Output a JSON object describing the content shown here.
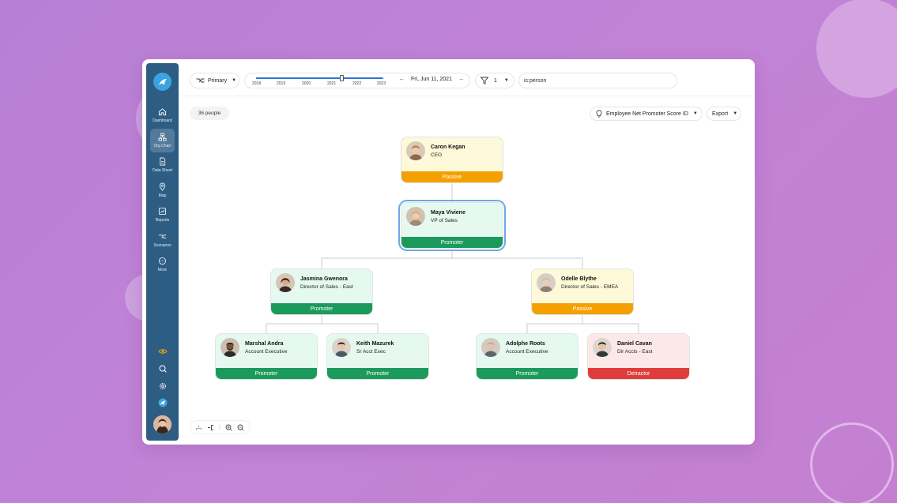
{
  "sidebar": {
    "items": [
      {
        "label": "Dashboard",
        "icon": "home-icon"
      },
      {
        "label": "Org Chart",
        "icon": "org-chart-icon",
        "active": true
      },
      {
        "label": "Data Sheet",
        "icon": "document-icon"
      },
      {
        "label": "Map",
        "icon": "map-pin-icon"
      },
      {
        "label": "Reports",
        "icon": "chart-icon"
      },
      {
        "label": "Scenarios",
        "icon": "scenarios-icon"
      },
      {
        "label": "More",
        "icon": "more-icon"
      }
    ],
    "bottom_icons": [
      "eye-icon",
      "search-icon",
      "gear-icon",
      "brand-icon"
    ]
  },
  "toolbar": {
    "view_label": "Primary",
    "years": [
      "2018",
      "2019",
      "2020",
      "2021",
      "2022",
      "2023"
    ],
    "timeline_position": 0.67,
    "date_label": "Fri, Jun 11, 2021",
    "filter_count": "1",
    "search_value": "is:person"
  },
  "header": {
    "people_count": "36 people",
    "metric_label": "Employee Net Promoter Score ID",
    "export_label": "Export"
  },
  "colors": {
    "promoter": "#1b9a5c",
    "passive": "#f4a000",
    "detractor": "#e03c3c",
    "sidebar": "#2e5d84"
  },
  "org": {
    "ceo": {
      "name": "Caron Kegan",
      "role": "CEO",
      "status": "Passive"
    },
    "vp": {
      "name": "Maya Viviene",
      "role": "VP of Sales",
      "status": "Promoter"
    },
    "dir_east": {
      "name": "Jasmina Gwenora",
      "role": "Director of Sales - East",
      "status": "Promoter"
    },
    "dir_emea": {
      "name": "Odelle Blythe",
      "role": "Director of Sales - EMEA",
      "status": "Passive"
    },
    "ae1": {
      "name": "Marshal Andra",
      "role": "Account Executive",
      "status": "Promoter"
    },
    "ae2": {
      "name": "Keith Mazurek",
      "role": "Sr Acct Exec",
      "status": "Promoter"
    },
    "ae3": {
      "name": "Adolphe Roots",
      "role": "Account Executive",
      "status": "Promoter"
    },
    "ae4": {
      "name": "Daniel Cavan",
      "role": "Dir Accts - East",
      "status": "Detractor"
    }
  }
}
